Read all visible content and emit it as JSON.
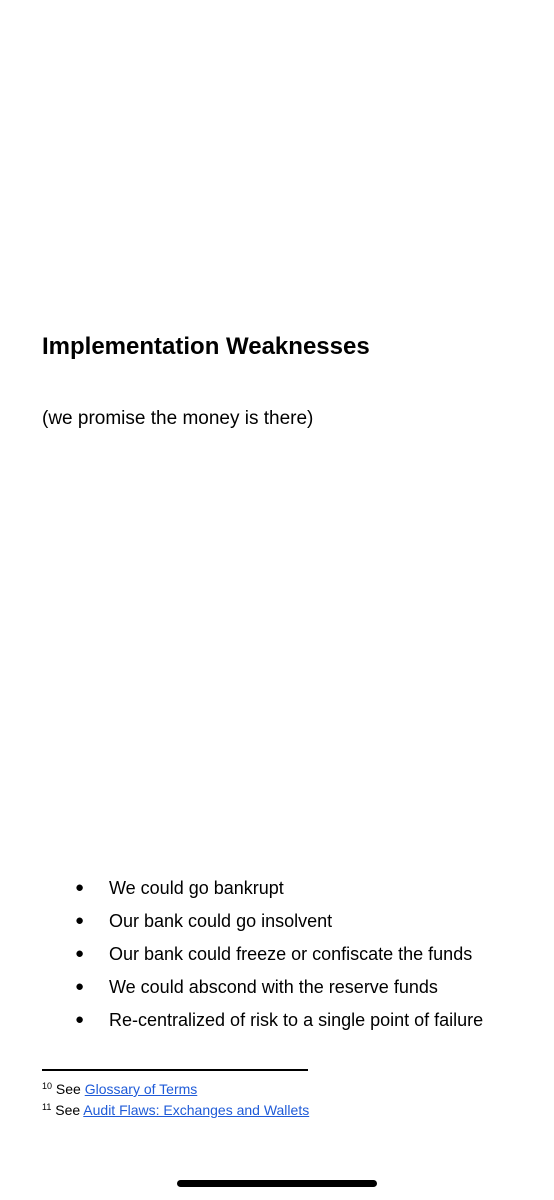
{
  "section": {
    "heading": "Implementation Weaknesses",
    "subtitle": "(we promise the money is there)"
  },
  "bullet_symbol": "●",
  "bullets": [
    "We could go bankrupt",
    "Our bank could go insolvent",
    "Our bank could freeze or confiscate the funds",
    "We could abscond with the reserve funds",
    "Re-centralized of risk to a single point of failure"
  ],
  "footnotes": [
    {
      "number": "10",
      "prefix": "See",
      "link_text": "Glossary of Terms"
    },
    {
      "number": "11",
      "prefix": "See",
      "link_text": "Audit Flaws: Exchanges and Wallets"
    }
  ],
  "colors": {
    "text": "#000000",
    "link": "#1f5bd8",
    "background": "#ffffff"
  }
}
